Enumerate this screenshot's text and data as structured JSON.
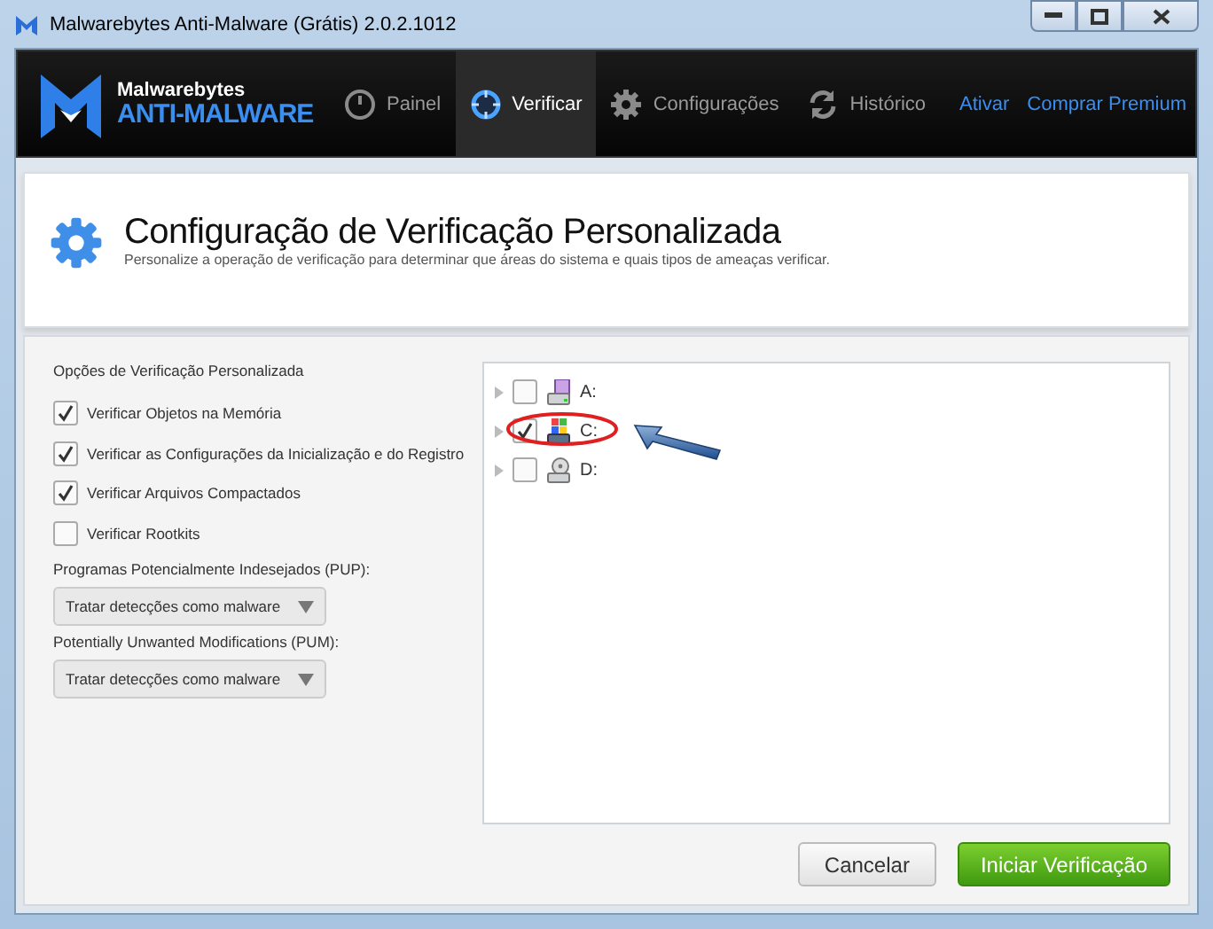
{
  "window": {
    "title": "Malwarebytes Anti-Malware (Grátis) 2.0.2.1012"
  },
  "brand": {
    "line1": "Malwarebytes",
    "line2": "ANTI-MALWARE"
  },
  "nav": [
    {
      "label": "Painel",
      "kind": "gauge",
      "selected": false
    },
    {
      "label": "Verificar",
      "kind": "target",
      "selected": true
    },
    {
      "label": "Configurações",
      "kind": "gear",
      "selected": false
    },
    {
      "label": "Histórico",
      "kind": "refresh",
      "selected": false
    }
  ],
  "links": [
    "Ativar",
    "Comprar Premium"
  ],
  "header": {
    "title": "Configuração de Verificação Personalizada",
    "subtitle": "Personalize a operação de verificação para determinar que áreas do sistema e quais tipos de ameaças verificar."
  },
  "options": {
    "heading": "Opções de Verificação Personalizada",
    "checks": [
      {
        "label": "Verificar Objetos na Memória",
        "checked": true
      },
      {
        "label": "Verificar as Configurações da Inicialização e do Registro",
        "checked": true
      },
      {
        "label": "Verificar Arquivos Compactados",
        "checked": true
      },
      {
        "label": "Verificar Rootkits",
        "checked": false
      }
    ],
    "dropdowns": [
      {
        "label": "Programas Potencialmente Indesejados (PUP):",
        "value": "Tratar detecções como malware"
      },
      {
        "label": "Potentially Unwanted Modifications (PUM):",
        "value": "Tratar detecções como malware"
      }
    ]
  },
  "drives": [
    {
      "label": "A:",
      "kind": "floppy",
      "checked": false,
      "highlighted": false
    },
    {
      "label": "C:",
      "kind": "system",
      "checked": true,
      "highlighted": true
    },
    {
      "label": "D:",
      "kind": "optical",
      "checked": false,
      "highlighted": false
    }
  ],
  "buttons": [
    {
      "label": "Cancelar",
      "kind": "secondary"
    },
    {
      "label": "Iniciar Verificação",
      "kind": "primary"
    }
  ]
}
